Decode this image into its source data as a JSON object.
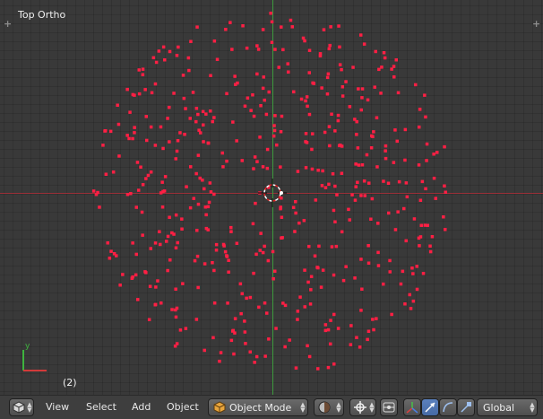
{
  "viewport": {
    "view_label": "Top Ortho",
    "frame_label": "(2)",
    "axis_gizmo": {
      "y": "y"
    },
    "colors": {
      "background": "#393939",
      "x_axis": "#9a2f38",
      "y_axis": "#3d9a3d",
      "particles": "#ff1f44"
    }
  },
  "header": {
    "editor_icon": "cube-icon",
    "menus": [
      "View",
      "Select",
      "Add",
      "Object"
    ],
    "mode": {
      "icon": "cube-orange-icon",
      "label": "Object Mode"
    },
    "shading_icon": "sphere-shading-icon",
    "pivot_icon": "pivot-point-icon",
    "manipulator_icons": [
      "manipulator-toggle-icon",
      "translate-icon",
      "rotate-icon",
      "scale-icon"
    ],
    "orientation": "Global"
  }
}
